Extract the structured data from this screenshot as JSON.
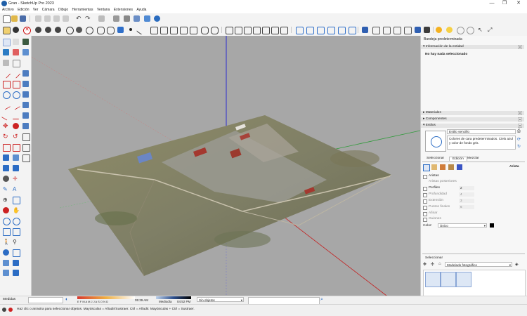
{
  "window": {
    "title": "Gran - SketchUp Pro 2023",
    "controls": [
      "—",
      "❐",
      "✕"
    ]
  },
  "menubar": [
    "Archivo",
    "Edición",
    "Ver",
    "Cámara",
    "Dibujo",
    "Herramientas",
    "Ventana",
    "Extensiones",
    "Ayuda"
  ],
  "icons": {
    "toolbar": [
      "new-file-icon",
      "open-icon",
      "save-icon",
      "cut-icon",
      "copy-icon",
      "paste-icon",
      "erase-icon",
      "undo-icon",
      "redo-icon",
      "print-icon",
      "model-info-icon",
      "warehouse-icon",
      "extension-icon",
      "select-icon",
      "paint-icon",
      "xray-icon",
      "back-edges-icon",
      "wireframe-icon",
      "hidden-line-icon",
      "shaded-icon",
      "textured-icon",
      "monochrome-icon",
      "shadows-icon",
      "fog-icon",
      "sun-icon",
      "section-plane-icon",
      "styles-icon"
    ],
    "colors": {
      "viewport_bg": "#a7a7a7",
      "axis_blue": "#2c2ccf",
      "axis_green": "#2f9b3a",
      "axis_red": "#c41f1f",
      "accent": "#1f5fa8"
    }
  },
  "tray": {
    "title": "Bandeja predeterminada",
    "entity_info": {
      "header": "Información de la entidad",
      "value": "No hay nada seleccionado"
    },
    "materials": "Materiales",
    "components": "Componentes",
    "styles": {
      "header": "Estilos",
      "style_name": "Estilo sencillo",
      "style_desc": "Colores de cara predeterminados. Cielo azul y color de fondo gris.",
      "tabs": [
        "Seleccionar",
        "Edición",
        "Mezclar"
      ],
      "section_label": "Arista",
      "options": {
        "aristas": "Aristas",
        "aristas_post": "Aristas posteriores",
        "perfiles": "Perfiles",
        "perfiles_val": "2",
        "profundidad": "Profundidad",
        "profundidad_val": "4",
        "extension": "Extensión",
        "extension_val": "3",
        "puntos": "Puntos finales",
        "puntos_val": "6",
        "afinar": "Afinar",
        "guiones": "Guiones"
      },
      "color_label": "Color:",
      "color_value": "Único"
    },
    "select_panel": {
      "header": "Seleccionar",
      "dropdown": "Modelado fotográfico"
    }
  },
  "statusbar": {
    "measure_label": "Medidas",
    "months": "E F M A M J J A S O N D",
    "time_sunrise": "05:39 AM",
    "time_mid": "Mediodía",
    "time_sunset": "04:52 PM",
    "no_objects": "Sin objetos",
    "help": "Haz clic o arrastra para seleccionar objetos. Mayúsculas = Añadir/Sustraer. Ctrl = Añadir. Mayúsculas + Ctrl = Sustraer."
  }
}
